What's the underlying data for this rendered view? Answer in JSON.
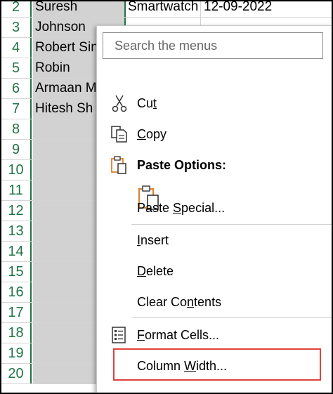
{
  "rows": [
    {
      "num": "2",
      "a": "Suresh",
      "b": "Smartwatch",
      "c": "12-09-2022"
    },
    {
      "num": "3",
      "a": "Johnson",
      "b": "",
      "c": ""
    },
    {
      "num": "4",
      "a": "Robert Sin",
      "b": "",
      "c": ""
    },
    {
      "num": "5",
      "a": "Robin",
      "b": "",
      "c": ""
    },
    {
      "num": "6",
      "a": "Armaan M",
      "b": "",
      "c": ""
    },
    {
      "num": "7",
      "a": "Hitesh Sh",
      "b": "",
      "c": ""
    },
    {
      "num": "8",
      "a": "",
      "b": "",
      "c": ""
    },
    {
      "num": "9",
      "a": "",
      "b": "",
      "c": ""
    },
    {
      "num": "10",
      "a": "",
      "b": "",
      "c": ""
    },
    {
      "num": "11",
      "a": "",
      "b": "",
      "c": ""
    },
    {
      "num": "12",
      "a": "",
      "b": "",
      "c": ""
    },
    {
      "num": "13",
      "a": "",
      "b": "",
      "c": ""
    },
    {
      "num": "14",
      "a": "",
      "b": "",
      "c": ""
    },
    {
      "num": "15",
      "a": "",
      "b": "",
      "c": ""
    },
    {
      "num": "16",
      "a": "",
      "b": "",
      "c": ""
    },
    {
      "num": "17",
      "a": "",
      "b": "",
      "c": ""
    },
    {
      "num": "18",
      "a": "",
      "b": "",
      "c": ""
    },
    {
      "num": "19",
      "a": "",
      "b": "",
      "c": ""
    },
    {
      "num": "20",
      "a": "",
      "b": "",
      "c": ""
    }
  ],
  "menu": {
    "search_placeholder": "Search the menus",
    "cut": {
      "pre": "Cu",
      "key": "t",
      "post": ""
    },
    "copy": {
      "pre": "",
      "key": "C",
      "post": "opy"
    },
    "paste_options": "Paste Options:",
    "paste_special": {
      "pre": "Paste ",
      "key": "S",
      "post": "pecial..."
    },
    "insert": {
      "pre": "",
      "key": "I",
      "post": "nsert"
    },
    "delete": {
      "pre": "",
      "key": "D",
      "post": "elete"
    },
    "clear_contents": {
      "pre": "Clear Co",
      "key": "n",
      "post": "tents"
    },
    "format_cells": {
      "pre": "",
      "key": "F",
      "post": "ormat Cells..."
    },
    "column_width": {
      "pre": "Column ",
      "key": "W",
      "post": "idth..."
    }
  },
  "colors": {
    "accent": "#217346",
    "highlight": "#e0413a",
    "icon_orange": "#d9822b"
  }
}
